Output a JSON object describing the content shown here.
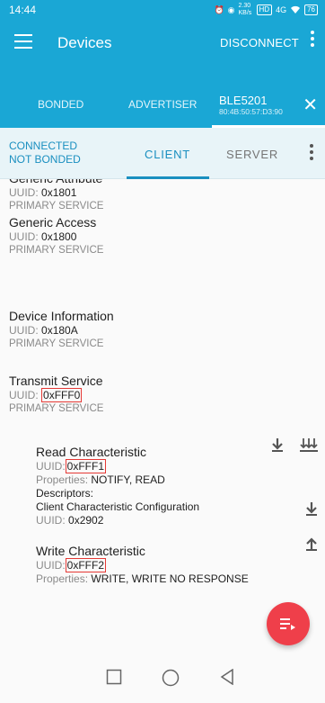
{
  "status_bar": {
    "time": "14:44",
    "net_speed": "2.30 KB/s",
    "hd": "HD",
    "signal": "4G",
    "battery": "76"
  },
  "app_bar": {
    "title": "Devices",
    "disconnect_label": "DISCONNECT"
  },
  "tabs": {
    "bonded": "BONDED",
    "advertiser": "ADVERTISER",
    "device_name": "BLE5201",
    "device_mac": "80:4B:50:57:D3:90"
  },
  "sub_bar": {
    "connected": "CONNECTED",
    "not_bonded": "NOT BONDED",
    "client": "CLIENT",
    "server": "SERVER"
  },
  "labels": {
    "uuid": "UUID:",
    "properties": "Properties:",
    "descriptors": "Descriptors:"
  },
  "services": [
    {
      "name": "Generic Attribute",
      "uuid": "0x1801",
      "type": "PRIMARY SERVICE"
    },
    {
      "name": "Generic Access",
      "uuid": "0x1800",
      "type": "PRIMARY SERVICE"
    },
    {
      "name": "Device Information",
      "uuid": "0x180A",
      "type": "PRIMARY SERVICE"
    },
    {
      "name": "Transmit Service",
      "uuid": "0xFFF0",
      "type": "PRIMARY SERVICE"
    }
  ],
  "characteristics": [
    {
      "name": "Read Characteristic",
      "uuid": "0xFFF1",
      "properties": "NOTIFY, READ",
      "descriptor_name": "Client Characteristic Configuration",
      "descriptor_uuid": "0x2902"
    },
    {
      "name": "Write Characteristic",
      "uuid": "0xFFF2",
      "properties": "WRITE, WRITE NO RESPONSE"
    }
  ],
  "icons": {
    "menu": "hamburger-icon",
    "more": "more-vert-icon",
    "close": "close-icon",
    "read": "download-icon",
    "notify": "multi-arrow-icon",
    "write": "upload-icon",
    "fab": "log-list-icon"
  },
  "colors": {
    "primary": "#1aa7d5",
    "fab": "#ef3f4a",
    "highlight": "#e53935"
  }
}
